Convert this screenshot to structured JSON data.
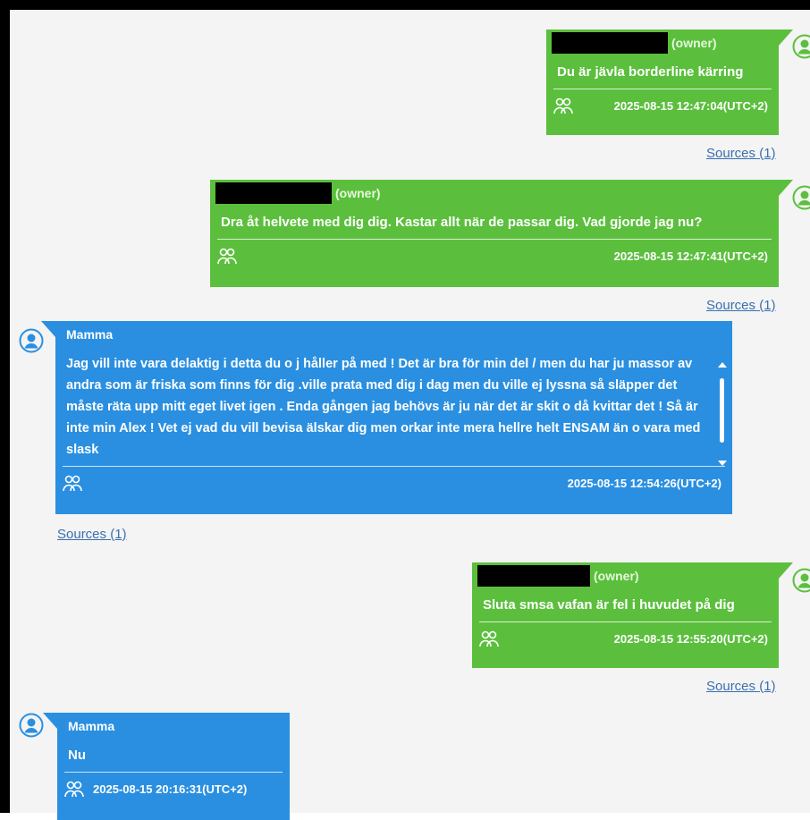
{
  "messages": [
    {
      "sender": "",
      "role": "(owner)",
      "text": "Du är jävla borderline kärring",
      "timestamp": "2025-08-15 12:47:04(UTC+2)",
      "sources": "Sources (1)"
    },
    {
      "sender": "",
      "role": "(owner)",
      "text": "Dra åt helvete med dig dig. Kastar allt när de passar dig. Vad gjorde jag nu?",
      "timestamp": "2025-08-15 12:47:41(UTC+2)",
      "sources": "Sources (1)"
    },
    {
      "sender": "Mamma",
      "text": "Jag vill inte vara delaktig i detta du o j håller på med ! Det är bra för min del / men du har ju massor av andra som är friska som finns för dig .ville prata med dig i dag men du ville ej lyssna så släpper det måste räta upp mitt eget livet igen .  Enda gången jag behövs är ju när det är skit o då kvittar det ! Så är inte min Alex ! Vet ej vad du vill bevisa älskar dig men orkar inte mera hellre helt ENSAM än o vara med slask",
      "timestamp": "2025-08-15 12:54:26(UTC+2)",
      "sources": "Sources (1)"
    },
    {
      "sender": "",
      "role": "(owner)",
      "text": "Sluta smsa vafan är fel i huvudet på dig",
      "timestamp": "2025-08-15 12:55:20(UTC+2)",
      "sources": "Sources (1)"
    },
    {
      "sender": "Mamma",
      "text": "Nu",
      "timestamp": "2025-08-15 20:16:31(UTC+2)"
    }
  ],
  "colors": {
    "outgoing": "#5bbf3d",
    "incoming": "#2a8fe0",
    "link": "#3a6fb0",
    "background": "#f4f4f4"
  },
  "icons": {
    "avatar": "person-circle-icon",
    "group": "group-icon"
  }
}
